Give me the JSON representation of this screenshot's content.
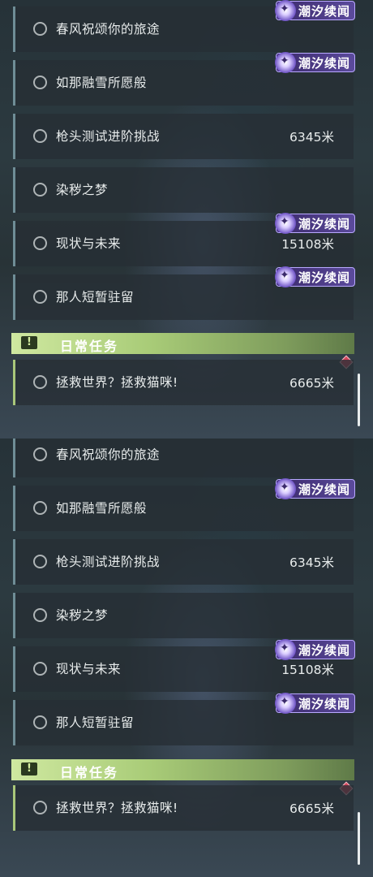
{
  "badge_label": "潮汐续闻",
  "section_title": "日常任务",
  "quests": [
    {
      "name": "春风祝颂你的旅途",
      "distance": ""
    },
    {
      "name": "如那融雪所愿般",
      "distance": ""
    },
    {
      "name": "枪头测试进阶挑战",
      "distance": "6345米"
    },
    {
      "name": "染秽之梦",
      "distance": ""
    },
    {
      "name": "现状与未来",
      "distance": "15108米"
    },
    {
      "name": "那人短暂驻留",
      "distance": ""
    }
  ],
  "daily_quest": {
    "name": "拯救世界？拯救猫咪!",
    "distance": "6665米"
  },
  "colors": {
    "badge": "#5b4a9c",
    "section": "#a9cc78",
    "alert": "#d6455b"
  },
  "icons": [
    "circle-icon",
    "sparkle-icon",
    "exclamation-icon",
    "diamond-icon"
  ]
}
